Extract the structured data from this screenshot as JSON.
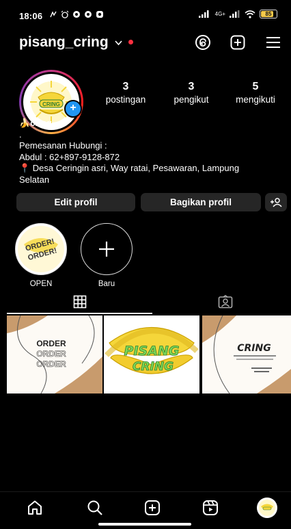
{
  "status_bar": {
    "time": "18:06",
    "network": "4G+",
    "battery": "85"
  },
  "header": {
    "username": "pisang_cring",
    "icons": [
      "threads-icon",
      "create-icon",
      "menu-icon"
    ]
  },
  "profile": {
    "avatar_label": "CRING",
    "stats": [
      {
        "count": "3",
        "label": "postingan"
      },
      {
        "count": "3",
        "label": "pengikut"
      },
      {
        "count": "5",
        "label": "mengikuti"
      }
    ],
    "name": "🍌cring",
    "bio_lines": [
      ".",
      "Pemesanan Hubungi :",
      "Abdul : 62+897-9128-872",
      "📍 Desa Ceringin asri, Way ratai, Pesawaran, Lampung",
      "Selatan"
    ]
  },
  "actions": {
    "edit": "Edit profil",
    "share": "Bagikan profil"
  },
  "highlights": [
    {
      "label": "OPEN",
      "cover_text": "ORDER! ORDER!"
    },
    {
      "label": "Baru"
    }
  ],
  "posts": [
    {
      "lines": [
        "ORDER",
        "ORDER",
        "ORDER"
      ]
    },
    {
      "title": "PISANG",
      "subtitle": "CRING"
    },
    {
      "title": "CRING"
    }
  ],
  "nav": [
    "home-icon",
    "search-icon",
    "create-icon",
    "reels-icon",
    "profile-avatar"
  ],
  "colors": {
    "accent": "#2196f3",
    "live_dot": "#ff3040",
    "button_bg": "#262626",
    "banana": "#f5d63a"
  }
}
